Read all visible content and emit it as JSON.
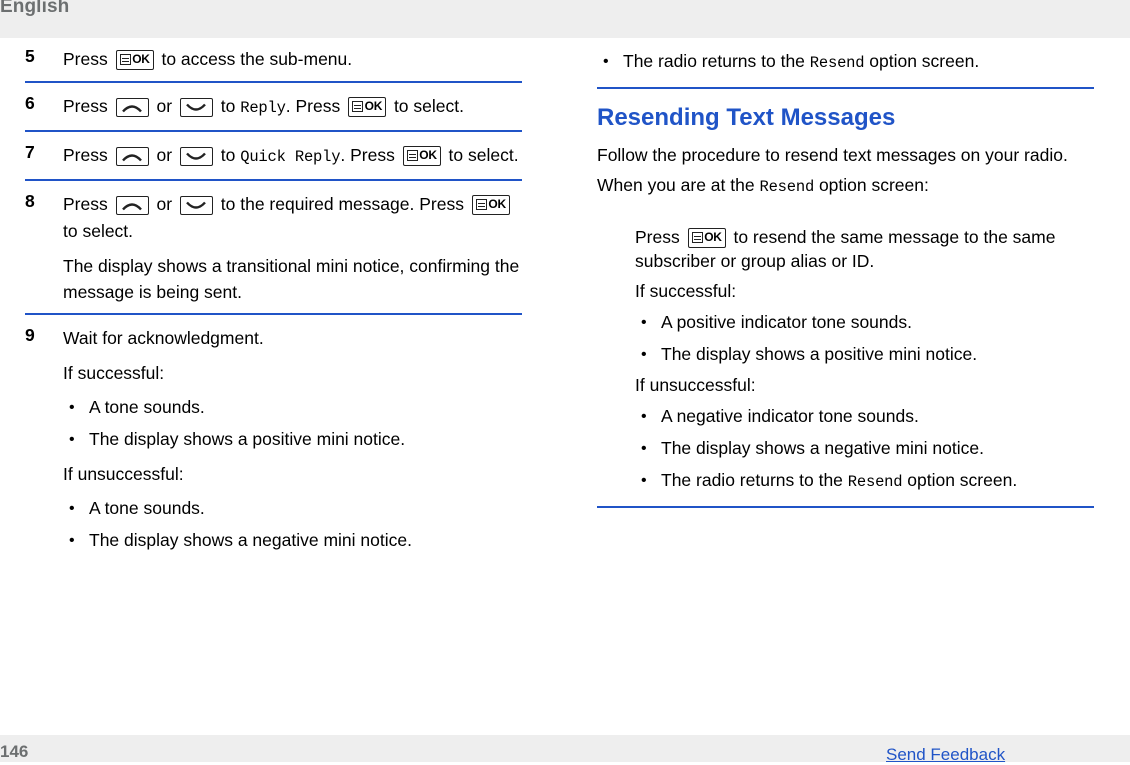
{
  "header": {
    "language": "English"
  },
  "footer": {
    "page_number": "146",
    "feedback_link": "Send Feedback"
  },
  "icons": {
    "ok_key": "ok-key-icon",
    "up_key": "up-arrow-key-icon",
    "down_key": "down-arrow-key-icon"
  },
  "left_column": {
    "steps": [
      {
        "number": "5",
        "parts": [
          {
            "type": "text",
            "value": "Press "
          },
          {
            "type": "icon",
            "value": "ok"
          },
          {
            "type": "text",
            "value": " to access the sub-menu."
          }
        ]
      },
      {
        "number": "6",
        "parts": [
          {
            "type": "text",
            "value": "Press "
          },
          {
            "type": "icon",
            "value": "up"
          },
          {
            "type": "text",
            "value": " or "
          },
          {
            "type": "icon",
            "value": "down"
          },
          {
            "type": "text",
            "value": " to "
          },
          {
            "type": "mono",
            "value": "Reply"
          },
          {
            "type": "text",
            "value": ". Press "
          },
          {
            "type": "icon",
            "value": "ok"
          },
          {
            "type": "text",
            "value": " to select."
          }
        ]
      },
      {
        "number": "7",
        "parts": [
          {
            "type": "text",
            "value": "Press "
          },
          {
            "type": "icon",
            "value": "up"
          },
          {
            "type": "text",
            "value": " or "
          },
          {
            "type": "icon",
            "value": "down"
          },
          {
            "type": "text",
            "value": " to "
          },
          {
            "type": "mono",
            "value": "Quick Reply"
          },
          {
            "type": "text",
            "value": ". Press "
          },
          {
            "type": "icon",
            "value": "ok"
          },
          {
            "type": "text",
            "value": " to select."
          }
        ]
      },
      {
        "number": "8",
        "parts": [
          {
            "type": "text",
            "value": "Press "
          },
          {
            "type": "icon",
            "value": "up"
          },
          {
            "type": "text",
            "value": " or "
          },
          {
            "type": "icon",
            "value": "down"
          },
          {
            "type": "text",
            "value": " to the required message. Press "
          },
          {
            "type": "icon",
            "value": "ok"
          },
          {
            "type": "text",
            "value": " to select."
          }
        ],
        "note": "The display shows a transitional mini notice, confirming the message is being sent."
      },
      {
        "number": "9",
        "parts": [
          {
            "type": "text",
            "value": "Wait for acknowledgment."
          }
        ],
        "success_label": "If successful:",
        "success_items": [
          "A tone sounds.",
          "The display shows a positive mini notice."
        ],
        "failure_label": "If unsuccessful:",
        "failure_items": [
          "A tone sounds.",
          "The display shows a negative mini notice."
        ]
      }
    ]
  },
  "right_column": {
    "top_bullet_parts": [
      {
        "type": "text",
        "value": "The radio returns to the "
      },
      {
        "type": "mono",
        "value": "Resend"
      },
      {
        "type": "text",
        "value": " option screen."
      }
    ],
    "section_title": "Resending Text Messages",
    "intro": "Follow the procedure to resend text messages on your radio.",
    "when_parts": [
      {
        "type": "text",
        "value": "When you are at the "
      },
      {
        "type": "mono",
        "value": "Resend"
      },
      {
        "type": "text",
        "value": " option screen:"
      }
    ],
    "press_parts": [
      {
        "type": "text",
        "value": "Press "
      },
      {
        "type": "icon",
        "value": "ok"
      },
      {
        "type": "text",
        "value": " to resend the same message to the same subscriber or group alias or ID."
      }
    ],
    "success_label": "If successful:",
    "success_items": [
      "A positive indicator tone sounds.",
      "The display shows a positive mini notice."
    ],
    "failure_label": "If unsuccessful:",
    "failure_items": [
      "A negative indicator tone sounds.",
      "The display shows a negative mini notice."
    ],
    "last_bullet_parts": [
      {
        "type": "text",
        "value": "The radio returns to the "
      },
      {
        "type": "mono",
        "value": "Resend"
      },
      {
        "type": "text",
        "value": " option screen."
      }
    ]
  }
}
